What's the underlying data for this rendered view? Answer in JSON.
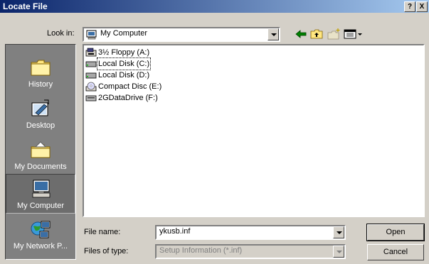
{
  "window": {
    "title": "Locate File",
    "help_label": "?",
    "close_label": "X"
  },
  "lookin": {
    "label": "Look in:",
    "value": "My Computer"
  },
  "places": [
    {
      "label": "History",
      "icon": "history-folder-icon"
    },
    {
      "label": "Desktop",
      "icon": "desktop-icon"
    },
    {
      "label": "My Documents",
      "icon": "my-documents-icon"
    },
    {
      "label": "My Computer",
      "icon": "my-computer-icon",
      "selected": true
    },
    {
      "label": "My Network P...",
      "icon": "network-places-icon"
    }
  ],
  "files": [
    {
      "label": "3½ Floppy (A:)",
      "icon": "floppy-drive-icon"
    },
    {
      "label": "Local Disk (C:)",
      "icon": "hard-disk-icon",
      "selected": true
    },
    {
      "label": "Local Disk (D:)",
      "icon": "hard-disk-icon"
    },
    {
      "label": "Compact Disc (E:)",
      "icon": "cd-drive-icon"
    },
    {
      "label": "2GDataDrive (F:)",
      "icon": "removable-drive-icon"
    }
  ],
  "filename": {
    "label": "File name:",
    "value": "ykusb.inf"
  },
  "filetype": {
    "label": "Files of type:",
    "value": "Setup Information (*.inf)"
  },
  "buttons": {
    "open": "Open",
    "cancel": "Cancel"
  }
}
